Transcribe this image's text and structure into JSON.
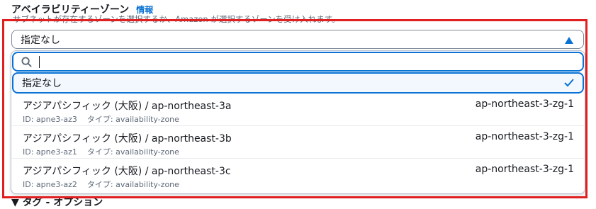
{
  "field": {
    "label": "アベイラビリティーゾーン",
    "info_link": "情報",
    "description": "サブネットが存在するゾーンを選択するか、Amazon が選択するゾーンを受け入れます。"
  },
  "select": {
    "selected_value": "指定なし",
    "caret_icon": "caret-up-filled-icon"
  },
  "filter": {
    "value": "",
    "icon": "search-icon"
  },
  "options": {
    "selected": {
      "label": "指定なし",
      "icon": "check-icon"
    },
    "items": [
      {
        "name": "アジアパシフィック (大阪) / ap-northeast-3a",
        "id": "ID: apne3-az3",
        "type": "タイプ: availability-zone",
        "group": "ap-northeast-3-zg-1"
      },
      {
        "name": "アジアパシフィック (大阪) / ap-northeast-3b",
        "id": "ID: apne3-az1",
        "type": "タイプ: availability-zone",
        "group": "ap-northeast-3-zg-1"
      },
      {
        "name": "アジアパシフィック (大阪) / ap-northeast-3c",
        "id": "ID: apne3-az2",
        "type": "タイプ: availability-zone",
        "group": "ap-northeast-3-zg-1"
      }
    ]
  },
  "next_section": {
    "label": "▼ タグ - オプション"
  },
  "colors": {
    "accent": "#0972d3",
    "highlight": "#e02020",
    "selected_bg": "#f2f8fd",
    "text": "#16191f",
    "muted": "#5f6b7a"
  }
}
